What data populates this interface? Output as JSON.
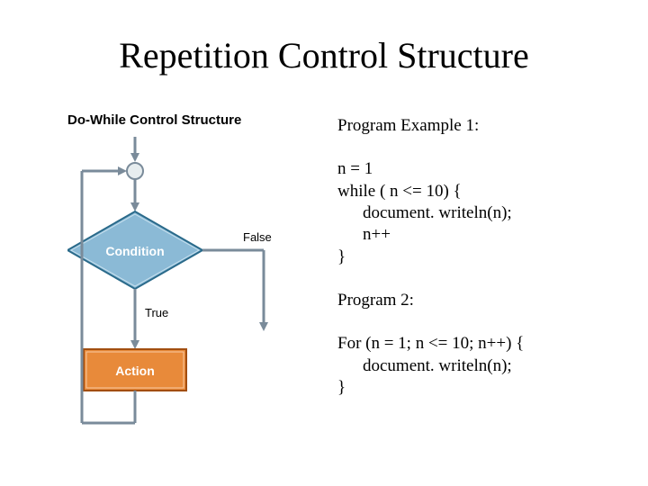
{
  "title": "Repetition Control Structure",
  "diagram": {
    "header": "Do-While Control Structure",
    "condition_label": "Condition",
    "action_label": "Action",
    "false_label": "False",
    "true_label": "True"
  },
  "right": {
    "heading1": "Program Example 1:",
    "code1_line1": "n = 1",
    "code1_line2": "while ( n <= 10) {",
    "code1_line3": "document. writeln(n);",
    "code1_line4": "n++",
    "code1_line5": "}",
    "heading2": "Program 2:",
    "code2_line1": "For (n = 1; n <= 10; n++) {",
    "code2_line2": "document. writeln(n);",
    "code2_line3": "}"
  }
}
